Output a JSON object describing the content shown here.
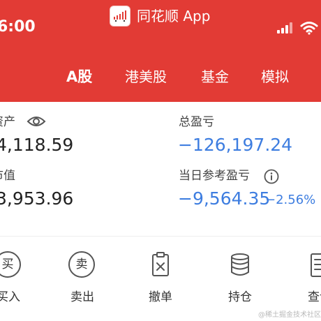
{
  "status_bar": {
    "time": "6:00"
  },
  "app": {
    "title": "同花顺 App"
  },
  "tabs": [
    {
      "label": "A股",
      "active": true
    },
    {
      "label": "港美股",
      "active": false
    },
    {
      "label": "基金",
      "active": false
    },
    {
      "label": "模拟",
      "active": false
    }
  ],
  "assets": {
    "total_assets_label": "资产",
    "total_assets_value": "4,118.59",
    "market_value_label": "市值",
    "market_value_value": "3,953.96",
    "total_pl_label": "总盈亏",
    "total_pl_value": "−126,197.24",
    "daily_pl_label": "当日参考盈亏",
    "daily_pl_value": "−9,564.35",
    "daily_pl_pct": "−2.56%"
  },
  "actions": [
    {
      "label": "买入",
      "glyph": "买",
      "icon": "buy-icon"
    },
    {
      "label": "卖出",
      "glyph": "卖",
      "icon": "sell-icon"
    },
    {
      "label": "撤单",
      "icon": "cancel-order-icon"
    },
    {
      "label": "持仓",
      "icon": "holdings-icon"
    },
    {
      "label": "查询",
      "icon": "query-icon"
    }
  ],
  "watermark": "@稀土掘金技术社区",
  "colors": {
    "brand_red": "#e23b35",
    "loss_blue": "#3d7de0"
  }
}
